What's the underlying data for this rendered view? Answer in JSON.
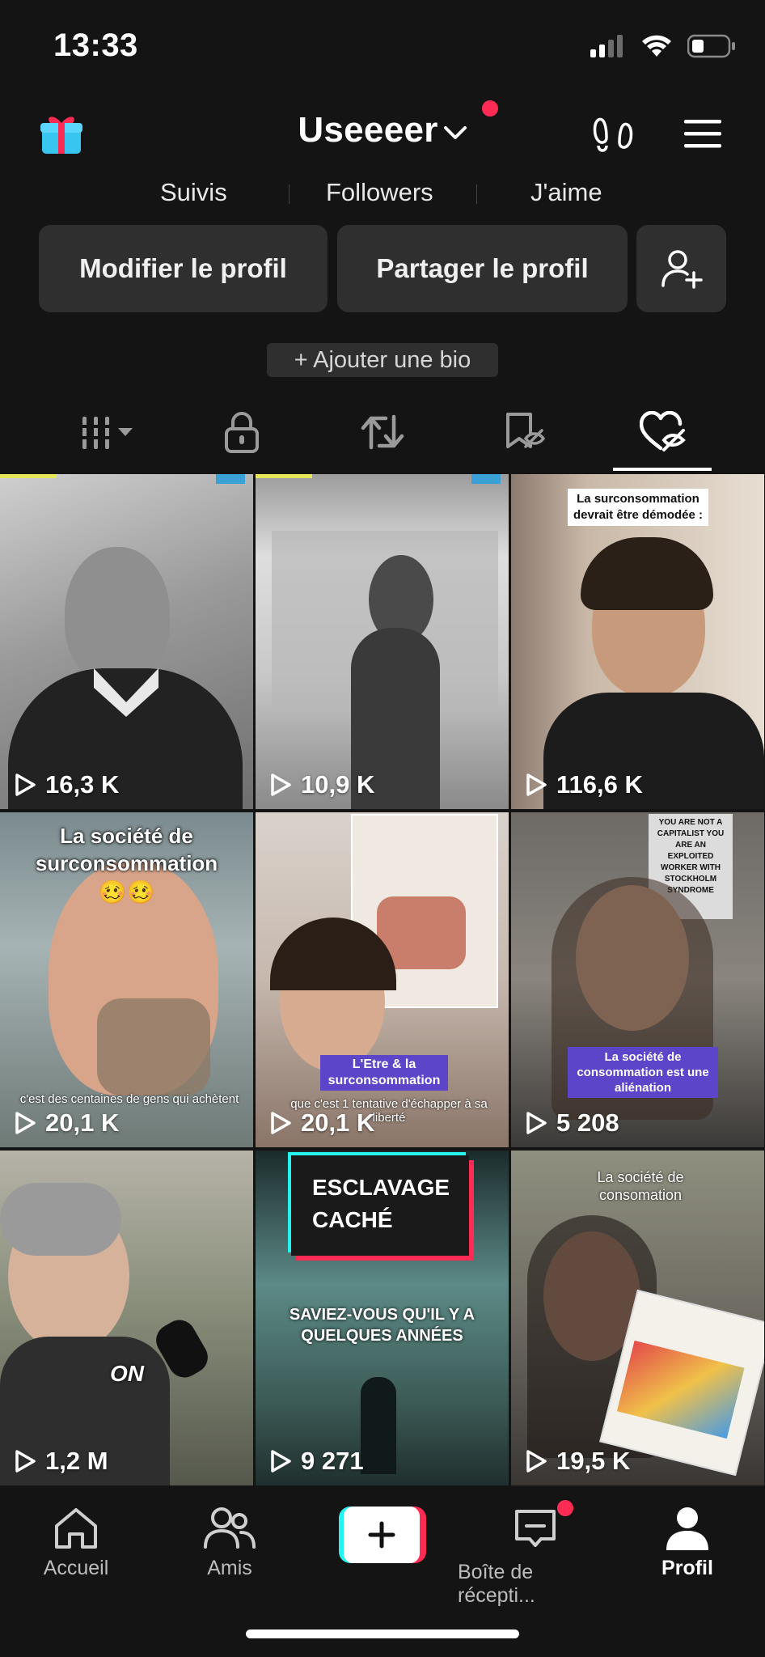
{
  "status_bar": {
    "time": "13:33"
  },
  "header": {
    "username": "Useeeer"
  },
  "stats": {
    "following_label": "Suivis",
    "followers_label": "Followers",
    "likes_label": "J'aime"
  },
  "actions": {
    "edit_profile": "Modifier le profil",
    "share_profile": "Partager le profil",
    "add_bio": "+ Ajouter une bio"
  },
  "tabs": [
    {
      "icon": "videos-grid-icon"
    },
    {
      "icon": "lock-icon"
    },
    {
      "icon": "repost-icon"
    },
    {
      "icon": "bookmark-hidden-icon"
    },
    {
      "icon": "liked-hidden-icon",
      "active": true
    }
  ],
  "videos": [
    {
      "views": "16,3 K"
    },
    {
      "views": "10,9 K"
    },
    {
      "views": "116,6 K",
      "caption": "La surconsommation devrait être démodée :"
    },
    {
      "views": "20,1 K",
      "caption": "La société de surconsommation",
      "emoji": "🥴🥴",
      "subtitle": "c'est des centaines de gens qui achètent"
    },
    {
      "views": "20,1 K",
      "caption": "L'Etre & la surconsommation",
      "subtitle": "que c'est 1 tentative d'échapper à sa liberté"
    },
    {
      "views": "5 208",
      "caption": "La société de consommation est une aliénation",
      "sign": "YOU ARE NOT A CAPITALIST YOU ARE AN EXPLOITED WORKER WITH STOCKHOLM SYNDROME"
    },
    {
      "views": "1,2 M",
      "caption": "ON"
    },
    {
      "views": "9 271",
      "caption": "ESCLAVAGE CACHÉ",
      "subtitle": "SAVIEZ-VOUS QU'IL Y A QUELQUES ANNÉES"
    },
    {
      "views": "19,5 K",
      "caption": "La société de consomation"
    }
  ],
  "nav": {
    "home": "Accueil",
    "friends": "Amis",
    "inbox": "Boîte de récepti...",
    "profile": "Profil"
  },
  "colors": {
    "accent": "#fe2c55",
    "cyan": "#25f4ee",
    "background": "#141414",
    "button": "#2f2f2f"
  }
}
